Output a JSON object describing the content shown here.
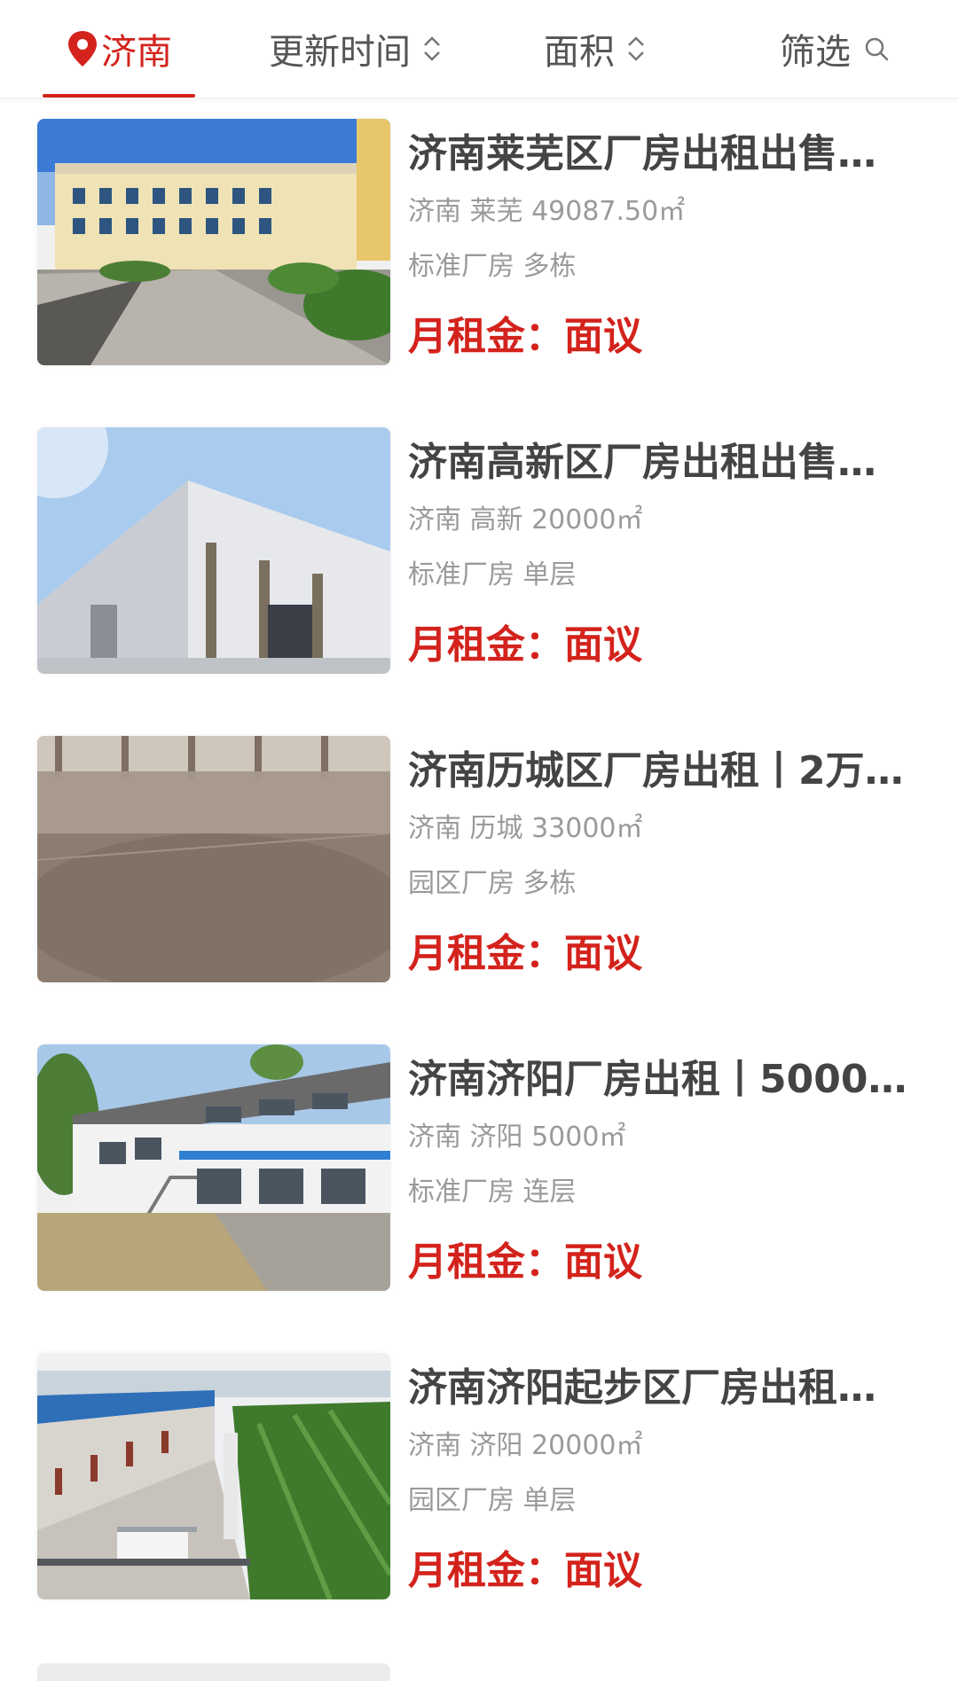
{
  "filter_bar": {
    "city": "济南",
    "update_time": "更新时间",
    "area": "面积",
    "filter": "筛选",
    "accent_color": "#d3231c"
  },
  "listings": [
    {
      "title": "济南莱芜区厂房出租出售…",
      "location": "济南 莱芜 49087.50㎡",
      "tags": "标准厂房 多栋",
      "price": "月租金：面议"
    },
    {
      "title": "济南高新区厂房出租出售…",
      "location": "济南 高新 20000㎡",
      "tags": "标准厂房 单层",
      "price": "月租金：面议"
    },
    {
      "title": "济南历城区厂房出租丨2万…",
      "location": "济南 历城 33000㎡",
      "tags": "园区厂房 多栋",
      "price": "月租金：面议"
    },
    {
      "title": "济南济阳厂房出租丨5000…",
      "location": "济南 济阳 5000㎡",
      "tags": "标准厂房 连层",
      "price": "月租金：面议"
    },
    {
      "title": "济南济阳起步区厂房出租…",
      "location": "济南 济阳 20000㎡",
      "tags": "园区厂房 单层",
      "price": "月租金：面议"
    }
  ]
}
